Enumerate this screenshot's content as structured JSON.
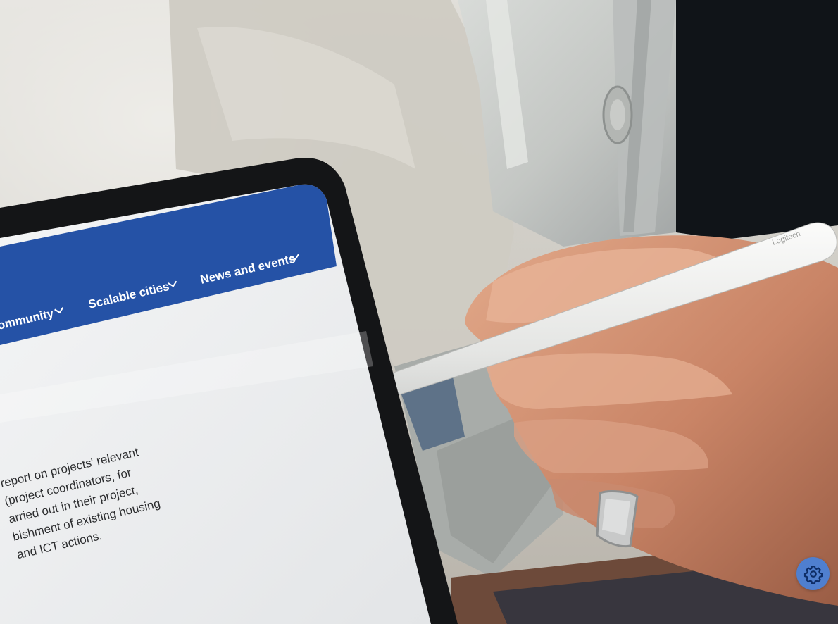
{
  "tablet_screen": {
    "nav": {
      "items": [
        {
          "label": "ommunity"
        },
        {
          "label": "Scalable cities"
        },
        {
          "label": "News and events"
        }
      ]
    },
    "body_lines": [
      "report on projects' relevant",
      "(project coordinators, for",
      "arried out in their project,",
      "bishment of existing housing",
      "and ICT actions."
    ]
  },
  "stylus_brand": "Logitech",
  "settings_button": {
    "icon": "gear-icon"
  },
  "colors": {
    "nav_blue": "#2552a6",
    "screen_bg": "#eceeef",
    "settings_blue": "#4f7fcf"
  }
}
